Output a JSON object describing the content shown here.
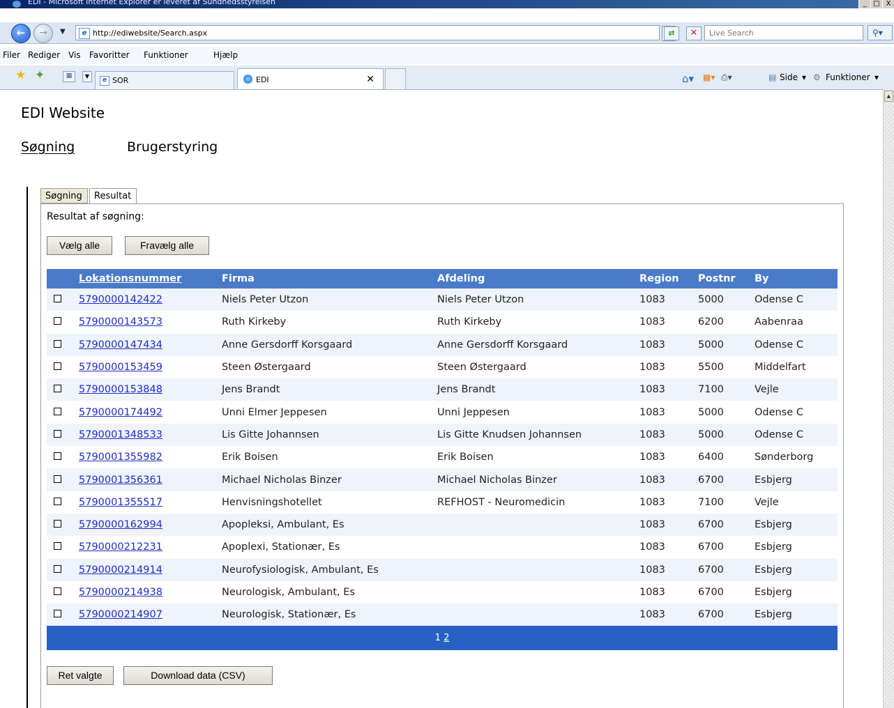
{
  "window": {
    "title": "EDI - Microsoft Internet Explorer er leveret af Sundhedsstyrelsen",
    "buttons": [
      "_",
      "□",
      "X"
    ]
  },
  "browser": {
    "url": "http://ediwebsite/Search.aspx",
    "search_placeholder": "Live Search",
    "menu": [
      "Filer",
      "Rediger",
      "Vis",
      "Favoritter",
      "Funktioner",
      "Hjælp"
    ],
    "tabs": [
      {
        "label": "SOR"
      },
      {
        "label": "EDI"
      }
    ],
    "commands": {
      "page": "Side",
      "tools": "Funktioner"
    }
  },
  "site": {
    "title": "EDI Website",
    "nav": [
      "Søgning",
      "Brugerstyring"
    ]
  },
  "panel": {
    "tabs": [
      "Søgning",
      "Resultat"
    ],
    "result_label": "Resultat af søgning:",
    "select_all": "Vælg alle",
    "deselect_all": "Fravælg alle",
    "edit_selected": "Ret valgte",
    "download": "Download data (CSV)"
  },
  "table": {
    "headers": [
      "Lokationsnummer",
      "Firma",
      "Afdeling",
      "Region",
      "Postnr",
      "By"
    ],
    "rows": [
      [
        "5790000142422",
        "Niels Peter Utzon",
        "Niels Peter Utzon",
        "1083",
        "5000",
        "Odense C"
      ],
      [
        "5790000143573",
        "Ruth Kirkeby",
        "Ruth Kirkeby",
        "1083",
        "6200",
        "Aabenraa"
      ],
      [
        "5790000147434",
        "Anne Gersdorff Korsgaard",
        "Anne Gersdorff Korsgaard",
        "1083",
        "5000",
        "Odense C"
      ],
      [
        "5790000153459",
        "Steen Østergaard",
        "Steen Østergaard",
        "1083",
        "5500",
        "Middelfart"
      ],
      [
        "5790000153848",
        "Jens Brandt",
        "Jens Brandt",
        "1083",
        "7100",
        "Vejle"
      ],
      [
        "5790000174492",
        "Unni Elmer Jeppesen",
        "Unni Jeppesen",
        "1083",
        "5000",
        "Odense C"
      ],
      [
        "5790001348533",
        "Lis Gitte Johannsen",
        "Lis Gitte Knudsen Johannsen",
        "1083",
        "5000",
        "Odense C"
      ],
      [
        "5790001355982",
        "Erik Boisen",
        "Erik Boisen",
        "1083",
        "6400",
        "Sønderborg"
      ],
      [
        "5790001356361",
        "Michael Nicholas Binzer",
        "Michael Nicholas Binzer",
        "1083",
        "6700",
        "Esbjerg"
      ],
      [
        "5790001355517",
        "Henvisningshotellet",
        "REFHOST - Neuromedicin",
        "1083",
        "7100",
        "Vejle"
      ],
      [
        "5790000162994",
        "Apopleksi, Ambulant, Es",
        "",
        "1083",
        "6700",
        "Esbjerg"
      ],
      [
        "5790000212231",
        "Apoplexi, Stationær, Es",
        "",
        "1083",
        "6700",
        "Esbjerg"
      ],
      [
        "5790000214914",
        "Neurofysiologisk, Ambulant, Es",
        "",
        "1083",
        "6700",
        "Esbjerg"
      ],
      [
        "5790000214938",
        "Neurologisk, Ambulant, Es",
        "",
        "1083",
        "6700",
        "Esbjerg"
      ],
      [
        "5790000214907",
        "Neurologisk, Stationær, Es",
        "",
        "1083",
        "6700",
        "Esbjerg"
      ]
    ],
    "pager": {
      "current": "1",
      "next": "2"
    }
  }
}
